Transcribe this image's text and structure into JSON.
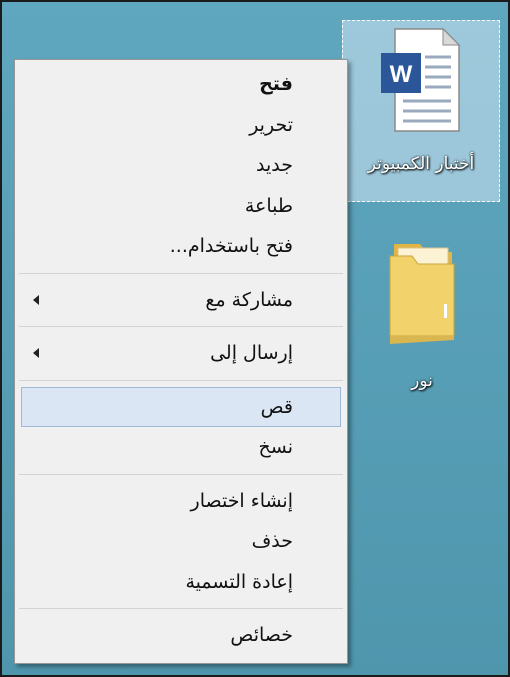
{
  "desktop": {
    "word_file_label": "أختبار الكمبيوتر",
    "folder_label": "نور"
  },
  "icons": {
    "word_badge": "W",
    "word_file_icon": "word-document-icon",
    "folder_icon": "folder-icon"
  },
  "context_menu": {
    "open": "فتح",
    "edit": "تحرير",
    "new": "جديد",
    "print": "طباعة",
    "open_with": "فتح باستخدام...",
    "share_with": "مشاركة مع",
    "send_to": "إرسال إلى",
    "cut": "قص",
    "copy": "نسخ",
    "create_shortcut": "إنشاء اختصار",
    "delete": "حذف",
    "rename": "إعادة التسمية",
    "properties": "خصائص"
  },
  "colors": {
    "desktop_bg": "#5a9db4",
    "menu_bg": "#f0f0f0",
    "hover_bg": "#dae6f3",
    "word_blue": "#2b579a",
    "folder_yellow": "#f2d36b"
  }
}
